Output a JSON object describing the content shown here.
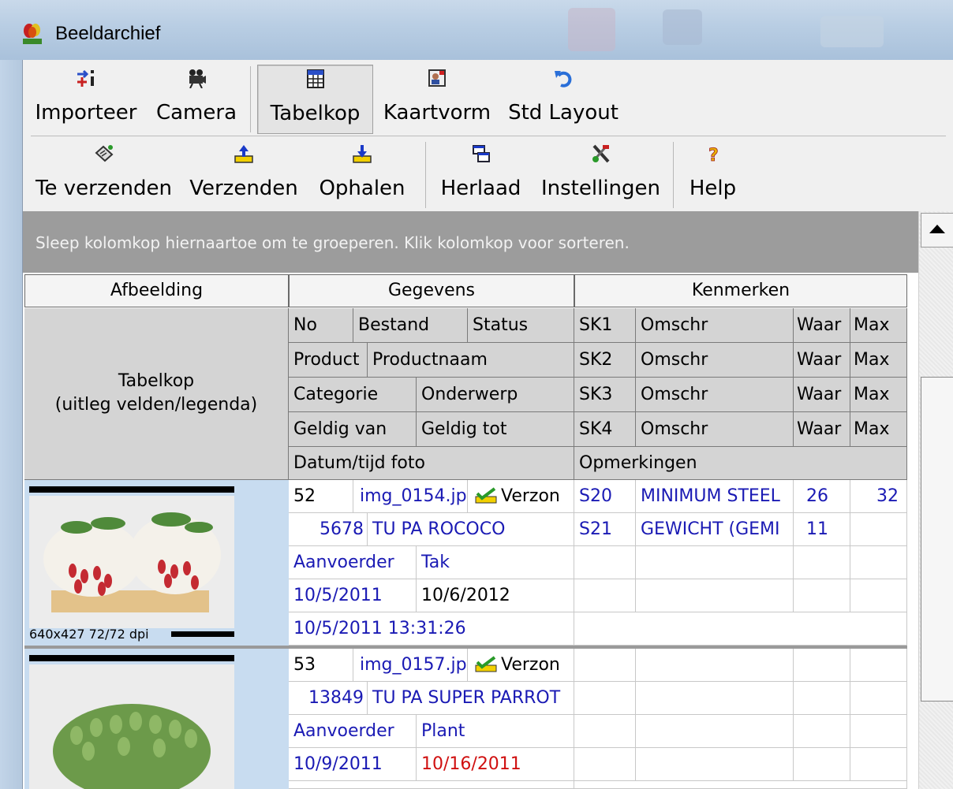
{
  "window": {
    "title": "Beeldarchief"
  },
  "toolbar_top": {
    "importeer": "Importeer",
    "camera": "Camera",
    "tabelkop": "Tabelkop",
    "kaartvorm": "Kaartvorm",
    "std_layout": "Std Layout"
  },
  "toolbar_bottom": {
    "te_verzenden": "Te verzenden",
    "verzenden": "Verzenden",
    "ophalen": "Ophalen",
    "herlaad": "Herlaad",
    "instellingen": "Instellingen",
    "help": "Help"
  },
  "group_panel": {
    "hint": "Sleep kolomkop hiernaartoe om te groeperen. Klik kolomkop voor sorteren."
  },
  "header": {
    "band_afbeelding": "Afbeelding",
    "band_gegevens": "Gegevens",
    "band_kenmerken": "Kenmerken",
    "legend_line1": "Tabelkop",
    "legend_line2": "(uitleg velden/legenda)",
    "no": "No",
    "bestand": "Bestand",
    "status": "Status",
    "product": "Product",
    "productnaam": "Productnaam",
    "categorie": "Categorie",
    "onderwerp": "Onderwerp",
    "geldig_van": "Geldig van",
    "geldig_tot": "Geldig tot",
    "datum_tijd": "Datum/tijd foto",
    "opmerkingen": "Opmerkingen",
    "sk1": "SK1",
    "sk2": "SK2",
    "sk3": "SK3",
    "sk4": "SK4",
    "omschr": "Omschr",
    "waar": "Waar",
    "max": "Max"
  },
  "records": [
    {
      "image_info": "640x427 72/72 dpi",
      "no": "52",
      "bestand": "img_0154.jp",
      "status": "Verzon",
      "product": "5678",
      "productnaam": "TU PA ROCOCO",
      "categorie": "Aanvoerder",
      "onderwerp": "Tak",
      "geldig_van": "10/5/2011",
      "geldig_tot": "10/6/2012",
      "datum_tijd": "10/5/2011 13:31:26",
      "sk1": "S20",
      "omschr1": "MINIMUM STEEL",
      "waar1": "26",
      "max1": "32",
      "sk2": "S21",
      "omschr2": "GEWICHT (GEMI",
      "waar2": "11"
    },
    {
      "no": "53",
      "bestand": "img_0157.jp",
      "status": "Verzon",
      "product": "13849",
      "productnaam": "TU PA SUPER PARROT",
      "categorie": "Aanvoerder",
      "onderwerp": "Plant",
      "geldig_van": "10/9/2011",
      "geldig_tot": "10/16/2011"
    }
  ],
  "colors": {
    "link_blue": "#1a1ab4",
    "expired_red": "#d01010",
    "group_panel": "#9c9c9c"
  }
}
